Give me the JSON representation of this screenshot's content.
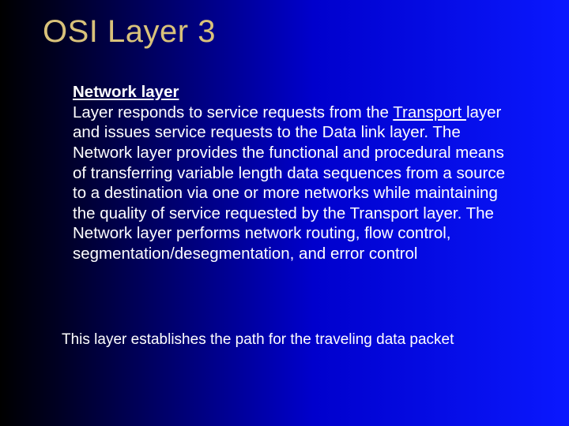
{
  "title": "OSI Layer 3",
  "heading": "Network layer",
  "body_parts": {
    "p1": "Layer responds to service requests from the ",
    "transport_link": "Transport ",
    "p2": "layer and issues service requests to the Data link layer. The Network layer provides the functional and procedural means of transferring variable length data sequences from a source to a destination via one or more networks while maintaining the quality of service requested by the Transport layer. The Network layer performs network routing, flow control, segmentation/desegmentation, and error control"
  },
  "footnote": "This layer establishes the path for the traveling data packet"
}
